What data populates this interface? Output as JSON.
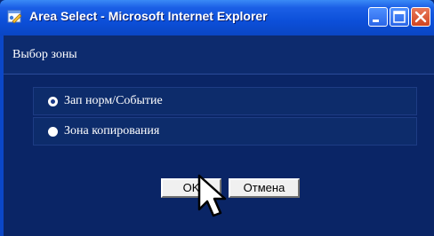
{
  "window": {
    "title": "Area Select - Microsoft Internet Explorer",
    "icon": "ie-icon",
    "controls": [
      "minimize-icon",
      "maximize-icon",
      "close-icon"
    ]
  },
  "dialog": {
    "header": "Выбор зоны",
    "options": [
      {
        "label": "Зап норм/Событие",
        "checked": true
      },
      {
        "label": "Зона копирования",
        "checked": false
      }
    ],
    "ok_label": "OK",
    "cancel_label": "Отмена"
  },
  "colors": {
    "titlebar": "#0c4fd9",
    "background": "#0a2566",
    "row": "#0d2c6b"
  },
  "cursor": "pointer-arrow-icon"
}
